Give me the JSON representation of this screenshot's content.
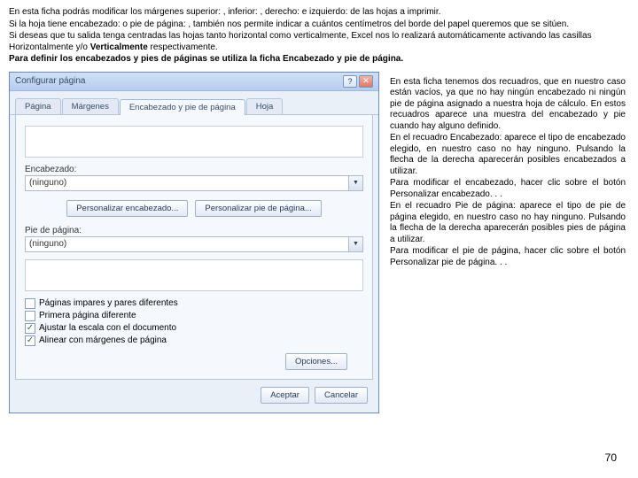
{
  "intro": {
    "p1": "En esta ficha podrás modificar los márgenes superior: , inferior: , derecho: e izquierdo: de las hojas a imprimir.",
    "p2": "Si la hoja tiene encabezado: o pie de página: , también nos permite indicar a cuántos centímetros del borde del papel queremos que se sitúen.",
    "p3_a": "Si deseas que tu salida tenga centradas las hojas tanto horizontal como verticalmente, Excel nos lo realizará automáticamente activando las casillas Horizontalmente y/o ",
    "p3_b": "Verticalmente",
    "p3_c": " respectivamente.",
    "p4": "Para definir los encabezados y pies de páginas se utiliza la ficha Encabezado y pie de página."
  },
  "dialog": {
    "title": "Configurar página",
    "tabs": [
      "Página",
      "Márgenes",
      "Encabezado y pie de página",
      "Hoja"
    ],
    "header_label": "Encabezado:",
    "header_value": "(ninguno)",
    "footer_label": "Pie de página:",
    "footer_value": "(ninguno)",
    "btn_custom_header": "Personalizar encabezado...",
    "btn_custom_footer": "Personalizar pie de página...",
    "chk_odd_even": "Páginas impares y pares diferentes",
    "chk_first_diff": "Primera página diferente",
    "chk_scale_doc": "Ajustar la escala con el documento",
    "chk_align_margins": "Alinear con márgenes de página",
    "btn_options": "Opciones...",
    "btn_accept": "Aceptar",
    "btn_cancel": "Cancelar"
  },
  "side": {
    "p1": "En esta ficha tenemos dos recuadros, que en nuestro caso están vacíos, ya que no hay ningún encabezado ni ningún pie de página asignado a nuestra hoja de cálculo. En estos recuadros aparece una muestra del encabezado y pie cuando hay alguno definido.",
    "p2": "En el recuadro Encabezado: aparece el tipo de encabezado elegido, en nuestro caso no hay ninguno. Pulsando la flecha de la derecha aparecerán posibles encabezados a utilizar.",
    "p3": "Para modificar el encabezado, hacer clic sobre el botón Personalizar encabezado. . .",
    "p4": "En el recuadro Pie de página: aparece el tipo de pie de página elegido, en nuestro caso no hay ninguno. Pulsando la flecha de la derecha aparecerán posibles pies de página a utilizar.",
    "p5": "Para modificar el pie de página, hacer clic sobre el botón Personalizar pie de página. . ."
  },
  "page_number": "70"
}
